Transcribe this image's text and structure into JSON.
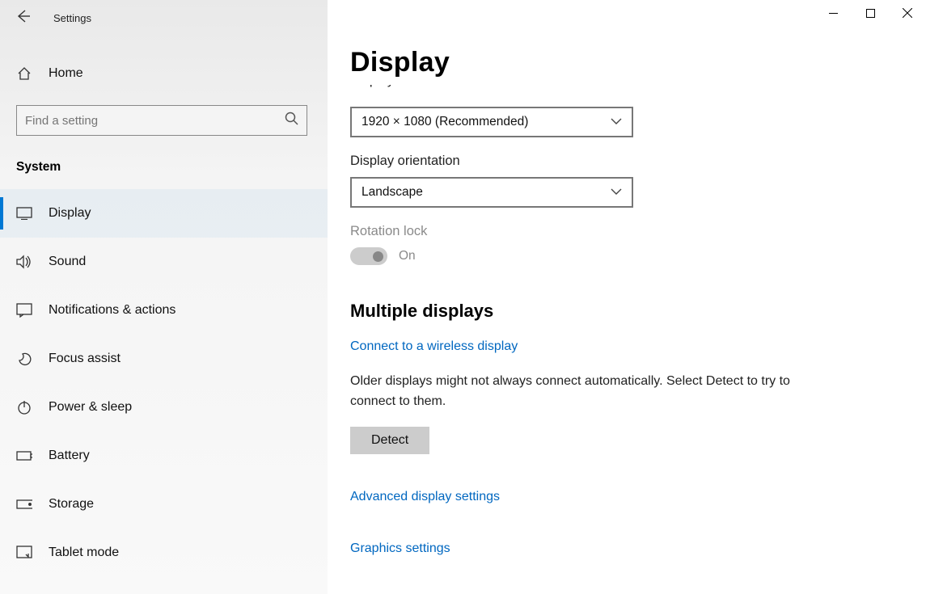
{
  "app_title": "Settings",
  "window_controls": {
    "minimize": "minimize",
    "maximize": "maximize",
    "close": "close"
  },
  "sidebar": {
    "home_label": "Home",
    "search_placeholder": "Find a setting",
    "category_label": "System",
    "items": [
      {
        "icon": "display",
        "label": "Display",
        "selected": true
      },
      {
        "icon": "sound",
        "label": "Sound"
      },
      {
        "icon": "notifications",
        "label": "Notifications & actions"
      },
      {
        "icon": "focus",
        "label": "Focus assist"
      },
      {
        "icon": "power",
        "label": "Power & sleep"
      },
      {
        "icon": "battery",
        "label": "Battery"
      },
      {
        "icon": "storage",
        "label": "Storage"
      },
      {
        "icon": "tablet",
        "label": "Tablet mode"
      }
    ]
  },
  "content": {
    "page_title": "Display",
    "resolution_label": "Display resolution",
    "resolution_value": "1920 × 1080 (Recommended)",
    "orientation_label": "Display orientation",
    "orientation_value": "Landscape",
    "rotation_lock_label": "Rotation lock",
    "rotation_lock_state": "On",
    "multiple_displays_header": "Multiple displays",
    "connect_wireless_link": "Connect to a wireless display",
    "detect_help_text": "Older displays might not always connect automatically. Select Detect to try to connect to them.",
    "detect_button": "Detect",
    "advanced_link": "Advanced display settings",
    "graphics_link": "Graphics settings"
  }
}
